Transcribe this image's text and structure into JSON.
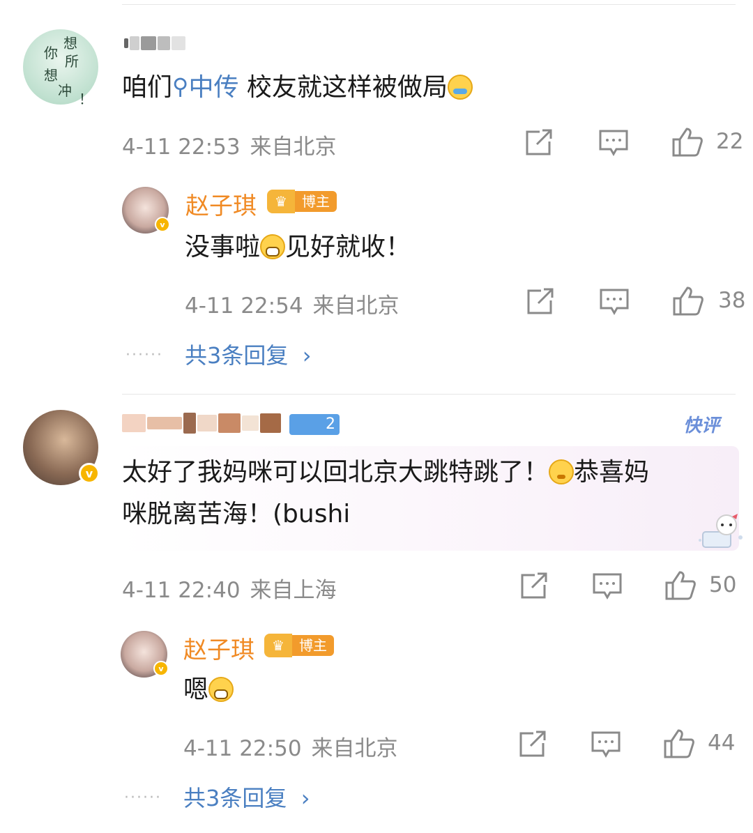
{
  "comments": [
    {
      "text_prefix": "咱们",
      "search_icon": "search-icon",
      "text_link": "中传",
      "text_suffix": " 校友就这样被做局",
      "emoji": "crying-emoji",
      "time": "4-11 22:53",
      "location": "来自北京",
      "likes": "22",
      "reply": {
        "name": "赵子琪",
        "badge": "博主",
        "text_prefix": "没事啦",
        "emoji": "grin-emoji",
        "text_suffix": "见好就收！",
        "time": "4-11 22:54",
        "location": "来自北京",
        "likes": "38"
      },
      "more_replies": "共3条回复",
      "more_arrow": "›"
    },
    {
      "badge_number": "2",
      "kuaiping": "快评",
      "text_line1_prefix": "太好了我妈咪可以回北京大跳特跳了！",
      "emoji": "moved-emoji",
      "text_line1_suffix": "恭喜妈",
      "text_line2": "咪脱离苦海！(bushi",
      "time": "4-11 22:40",
      "location": "来自上海",
      "likes": "50",
      "reply": {
        "name": "赵子琪",
        "badge": "博主",
        "text_prefix": "嗯",
        "emoji": "grin-emoji",
        "time": "4-11 22:50",
        "location": "来自北京",
        "likes": "44"
      },
      "more_replies": "共3条回复",
      "more_arrow": "›"
    }
  ],
  "avatar_overlay_chars": [
    "想",
    "你",
    "所",
    "想",
    "冲",
    "！"
  ],
  "verified_badge": "v",
  "dots": "······",
  "colors": {
    "link": "#4a7fc1",
    "username_orange": "#f08a24",
    "meta_gray": "#8a8a8a",
    "badge_orange": "#f29b2c"
  }
}
